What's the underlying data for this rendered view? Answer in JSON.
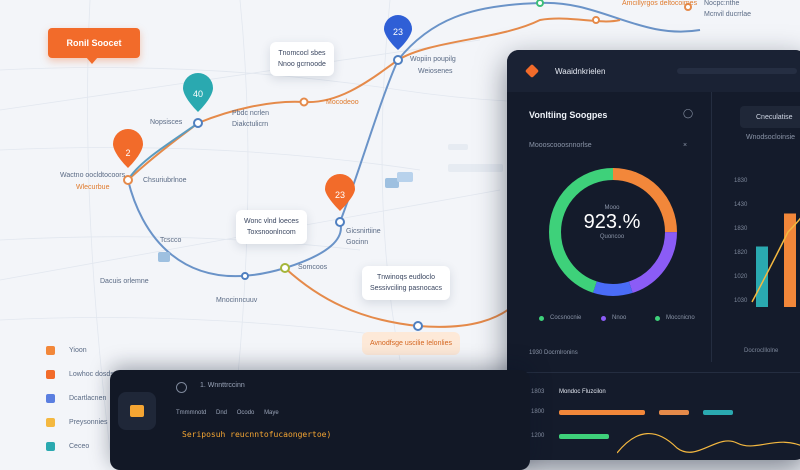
{
  "map": {
    "badge_label": "Ronil Soocet",
    "pins": [
      {
        "label": "40",
        "color": "#2aa9b0"
      },
      {
        "label": "2",
        "color": "#f26b2a"
      },
      {
        "label": "23",
        "color": "#2f5fd6"
      },
      {
        "label": "23",
        "color": "#f26b2a"
      }
    ],
    "labels": [
      "Nopsisces",
      "Pbdc ncrlen",
      "Diakctulicrn",
      "Mocodeoo",
      "Wopiin poupilg",
      "Weiosenes",
      "Chsuriubrlnoe",
      "Wlecurbue",
      "Gicsnirtiine",
      "Gocinn",
      "Somcoos",
      "Dacuis orlemne",
      "Mnocinncuuv",
      "Amcillyrgos deltocoimes",
      "Nocpc:nthe",
      "Mcnvil ducrrlae",
      "Tcscco",
      "Wactno oocldtocoors"
    ],
    "callouts": [
      {
        "line1": "Tnomcocl sbes",
        "line2": "Nnoo gcrnoode"
      },
      {
        "line1": "Wonc vlnd loeces",
        "line2": "Toxsnoonlncom"
      },
      {
        "line1": "Tnwinoqs eudloclo",
        "line2": "Sessivciling pasnocacs"
      }
    ],
    "pill_label": "Avnodfsge uscilie Ielonlies",
    "legend": [
      {
        "label": "Yioon",
        "color": "#f2873a"
      },
      {
        "label": "Lowhoc dosdsde",
        "color": "#f26b2a"
      },
      {
        "label": "Dcartlacnen",
        "color": "#5a7ee0"
      },
      {
        "label": "Preysonnies",
        "color": "#f4b840"
      },
      {
        "label": "Ceceo",
        "color": "#2aa9b0"
      }
    ]
  },
  "dashboard": {
    "app_name": "Waaidnkrielen",
    "title": "Vonltiing Soogpes",
    "subtitle": "Moooscooosnnorlse",
    "panel_button": "Cneculatise",
    "panel_subtitle": "Wnodsocloinsie",
    "donut": {
      "value_label": "923.%",
      "top_label": "Mooo",
      "bottom_label": "Quoncoo",
      "segments": [
        {
          "value": 0.25,
          "color": "#f2873a"
        },
        {
          "value": 0.2,
          "color": "#8b5cf6"
        },
        {
          "value": 0.1,
          "color": "#4a6cf7"
        },
        {
          "value": 0.45,
          "color": "#3ed17a"
        }
      ]
    },
    "legend": [
      {
        "label": "Cocsnocnie",
        "color": "#3ed17a"
      },
      {
        "label": "Nnoo",
        "color": "#8b5cf6"
      },
      {
        "label": "Moccnicno",
        "color": "#3ed17a"
      }
    ],
    "axis_labels": [
      "1830",
      "1430",
      "1830",
      "1820",
      "1020",
      "1030"
    ],
    "footer_left": "1930 Docrnlronins",
    "footer_right": "Docroclllolne",
    "bar_values": [
      0.55,
      0.85
    ],
    "rows": [
      {
        "label": "1803",
        "name": "Mondoc Fluzcilon"
      },
      {
        "label": "1800"
      },
      {
        "label": "1200"
      }
    ]
  },
  "code": {
    "breadcrumb": "1. Wnnttrccinn",
    "tabs": [
      "Tmmmnotd",
      "Dnd",
      "Ocodo",
      "Maye"
    ],
    "line": "Seriposuh  reucnntofucaongertoe)"
  }
}
